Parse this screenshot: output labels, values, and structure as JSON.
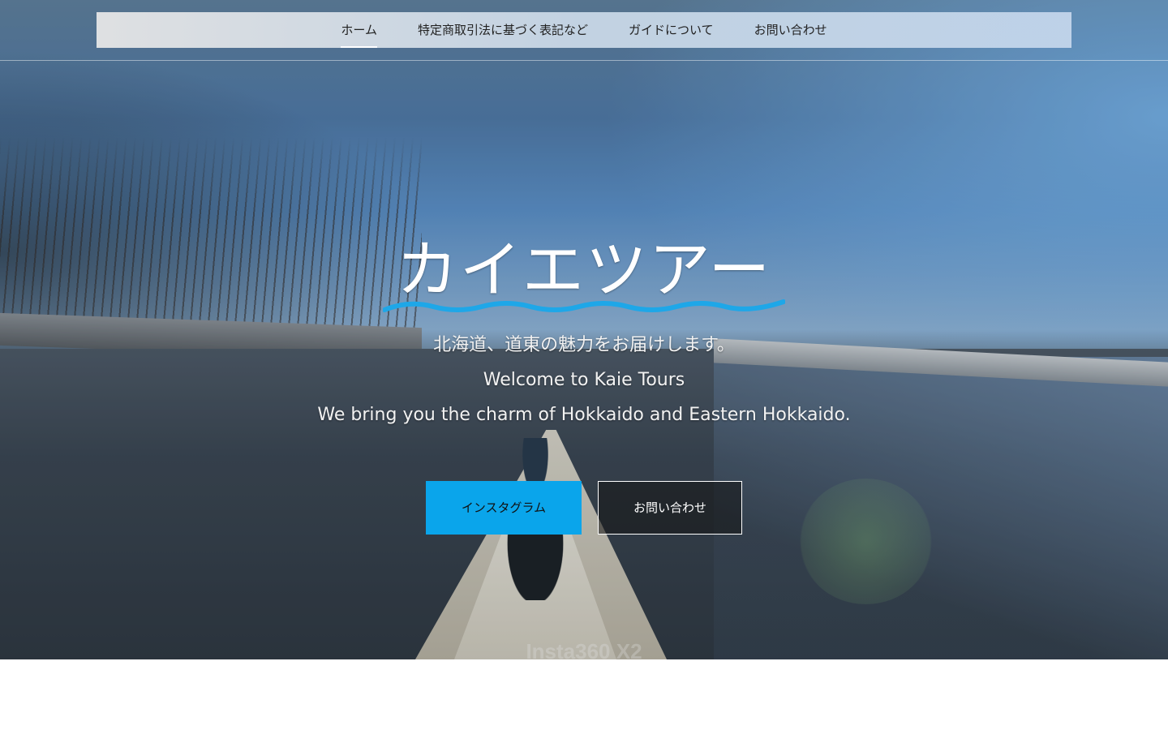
{
  "nav": {
    "items": [
      {
        "label": "ホーム",
        "active": true
      },
      {
        "label": "特定商取引法に基づく表記など",
        "active": false
      },
      {
        "label": "ガイドについて",
        "active": false
      },
      {
        "label": "お問い合わせ",
        "active": false
      }
    ]
  },
  "hero": {
    "title": "カイエツアー",
    "subtitle_lines": [
      "北海道、道東の魅力をお届けします。",
      "Welcome to Kaie Tours",
      "We bring you the charm of Hokkaido and Eastern Hokkaido."
    ],
    "watermark": "Insta360 X2",
    "wave_color": "#1ea7e8"
  },
  "buttons": {
    "instagram": "インスタグラム",
    "contact": "お問い合わせ"
  },
  "colors": {
    "primary_button": "#0aa5eb",
    "accent": "#1ea7e8"
  }
}
